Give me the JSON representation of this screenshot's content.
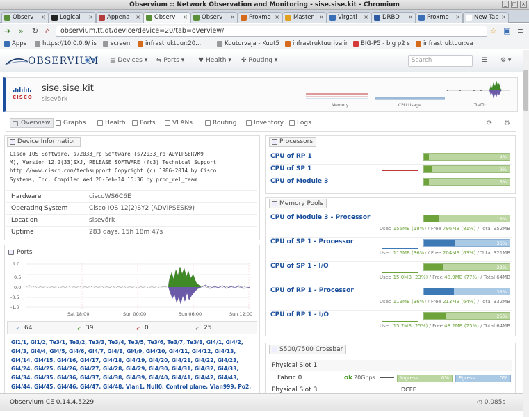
{
  "window": {
    "title": "Observium :: Network Observation and Monitoring - sise.sise.kit - Chromium"
  },
  "tabs": [
    {
      "label": "Observ",
      "color": "#5a8f3a"
    },
    {
      "label": "Logical",
      "color": "#222222"
    },
    {
      "label": "Appena",
      "color": "#b43c3c"
    },
    {
      "label": "Observ",
      "color": "#5a8f3a"
    },
    {
      "label": "Observ",
      "color": "#5a8f3a"
    },
    {
      "label": "Proxmo",
      "color": "#d46a1a"
    },
    {
      "label": "Master",
      "color": "#e0a020"
    },
    {
      "label": "Virgati",
      "color": "#3a6fb5"
    },
    {
      "label": "DRBD",
      "color": "#2d5aa0"
    },
    {
      "label": "Proxmo",
      "color": "#3a6fb5"
    },
    {
      "label": "New Tab",
      "color": "#ffffff"
    }
  ],
  "omnibox": {
    "url": "observium.tt.dt/device/device=20/tab=overview/"
  },
  "bookmarks": [
    {
      "label": "Apps",
      "color": "#3a6fb5"
    },
    {
      "label": "https://10.0.0.9/ is",
      "color": "#999999"
    },
    {
      "label": "screen",
      "color": "#999999"
    },
    {
      "label": "infrastruktuur:20...",
      "color": "#d46a1a"
    },
    {
      "label": "Kuutorvaja - Kuut5",
      "color": "#999999"
    },
    {
      "label": "infrastruktuurivalir",
      "color": "#d46a1a"
    },
    {
      "label": "BIG-P5 - big p2 s",
      "color": "#d43a3a"
    },
    {
      "label": "infrastruktuur:va",
      "color": "#d46a1a"
    }
  ],
  "nav": {
    "logo": "OBSERVIUM",
    "items": [
      "Devices",
      "Ports",
      "Health",
      "Routing"
    ],
    "search_placeholder": "Search"
  },
  "device": {
    "name": "sise.sise.kit",
    "location": "sisevõrk",
    "vendor_logo_text": "CISCO",
    "mini_graphs": [
      "Memory",
      "CPU Usage",
      "Traffic"
    ]
  },
  "device_tabs": [
    "Overview",
    "Graphs",
    "Health",
    "Ports",
    "VLANs",
    "Routing",
    "Inventory",
    "Logs"
  ],
  "info_panel": {
    "title": "Device Information",
    "description_lines": [
      "Cisco IOS Software, s72033_rp Software (s72033_rp ADVIPSERVK9",
      "M), Version 12.2(33)SXJ, RELEASE SOFTWARE (fc3) Technical Support:",
      "http://www.cisco.com/techsupport Copyright (c) 1986-2014 by Cisco",
      "Systems, Inc. Compiled Wed 26-Feb-14 15:36 by prod_rel_team"
    ],
    "rows": [
      {
        "key": "Hardware",
        "value": "ciscoWS6C6E"
      },
      {
        "key": "Operating System",
        "value": "Cisco IOS 12(2)SY2 (ADVIPSESK9)"
      },
      {
        "key": "Location",
        "value": "sisevõrk"
      },
      {
        "key": "Uptime",
        "value": "283 days, 15h 18m 47s"
      }
    ]
  },
  "ports_panel": {
    "title": "Ports",
    "y_labels": [
      "1.0",
      "0.5",
      "0.0",
      "-0.5",
      "-1.0"
    ],
    "x_labels": [
      "Sat 18:00",
      "Sun 00:00",
      "Sun 06:00",
      "Sun 12:00"
    ],
    "counts": [
      {
        "value": "64",
        "color": "#3a6fb5",
        "icon": "port-icon"
      },
      {
        "value": "39",
        "color": "#4a9a2a",
        "icon": "port-up-icon"
      },
      {
        "value": "0",
        "color": "#c23a3a",
        "icon": "port-down-icon"
      },
      {
        "value": "25",
        "color": "#888888",
        "icon": "port-disabled-icon"
      }
    ],
    "port_list": "Gi1/1, Gi1/2, Te3/1, Te3/2, Te3/3, Te3/4, Te3/5, Te3/6, Te3/7, Te3/8, Gi4/1, Gi4/2, Gi4/3, Gi4/4, Gi4/5, Gi4/6, Gi4/7, Gi4/8, Gi4/9, Gi4/10, Gi4/11, Gi4/12, Gi4/13, Gi4/14, Gi4/15, Gi4/16, Gi4/17, Gi4/18, Gi4/19, Gi4/20, Gi4/21, Gi4/22, Gi4/23, Gi4/24, Gi4/25, Gi4/26, Gi4/27, Gi4/28, Gi4/29, Gi4/30, Gi4/31, Gi4/32, Gi4/33, Gi4/34, Gi4/35, Gi4/36, Gi4/37, Gi4/38, Gi4/39, Gi4/40, Gi4/41, Gi4/42, Gi4/43, Gi4/44, Gi4/45, Gi4/46, Gi4/47, Gi4/48, Vlan1, Null0, Control plane, Vlan999, Po2, Po1"
  },
  "processors_panel": {
    "title": "Processors",
    "items": [
      {
        "name": "CPU of RP 1",
        "pct_label": "4%",
        "value": 4
      },
      {
        "name": "CPU of SP 1",
        "pct_label": "9%",
        "value": 9
      },
      {
        "name": "CPU of Module 3",
        "pct_label": "5%",
        "value": 5
      }
    ]
  },
  "memory_panel": {
    "title": "Memory Pools",
    "items": [
      {
        "name": "CPU of Module 3 - Processor",
        "pct_label": "18%",
        "value": 18,
        "type": "green",
        "used": "156MB (18%)",
        "free": "796MB (81%)",
        "total": "Total 952MB"
      },
      {
        "name": "CPU of SP 1 - Processor",
        "pct_label": "36%",
        "value": 36,
        "type": "blue",
        "used": "116MB (36%)",
        "free": "204MB (63%)",
        "total": "Total 321MB"
      },
      {
        "name": "CPU of SP 1 - I/O",
        "pct_label": "23%",
        "value": 23,
        "type": "green",
        "used": "15.0MB (23%)",
        "free": "48.9MB (77%)",
        "total": "Total 64MB"
      },
      {
        "name": "CPU of RP 1 - Processor",
        "pct_label": "35%",
        "value": 35,
        "type": "blue",
        "used": "119MB (36%)",
        "free": "213MB (64%)",
        "total": "Total 332MB"
      },
      {
        "name": "CPU of RP 1 - I/O",
        "pct_label": "25%",
        "value": 25,
        "type": "green",
        "used": "15.7MB (25%)",
        "free": "48.2MB (75%)",
        "total": "Total 64MB"
      }
    ]
  },
  "crossbar_panel": {
    "title": "S500/7500 Crossbar",
    "slot1": "Physical Slot 1",
    "fabric": "Fabric 0",
    "fabric_status": "ok",
    "fabric_speed": "20Gbps",
    "ingress_label": "Ingress",
    "ingress_pct": "0%",
    "egress_label": "Egress",
    "egress_pct": "0%",
    "slot3": "Physical Slot 3",
    "slot3_status": "DCEF"
  },
  "footer": {
    "version": "Observium CE 0.14.4.5229",
    "timing": "0.085s"
  }
}
